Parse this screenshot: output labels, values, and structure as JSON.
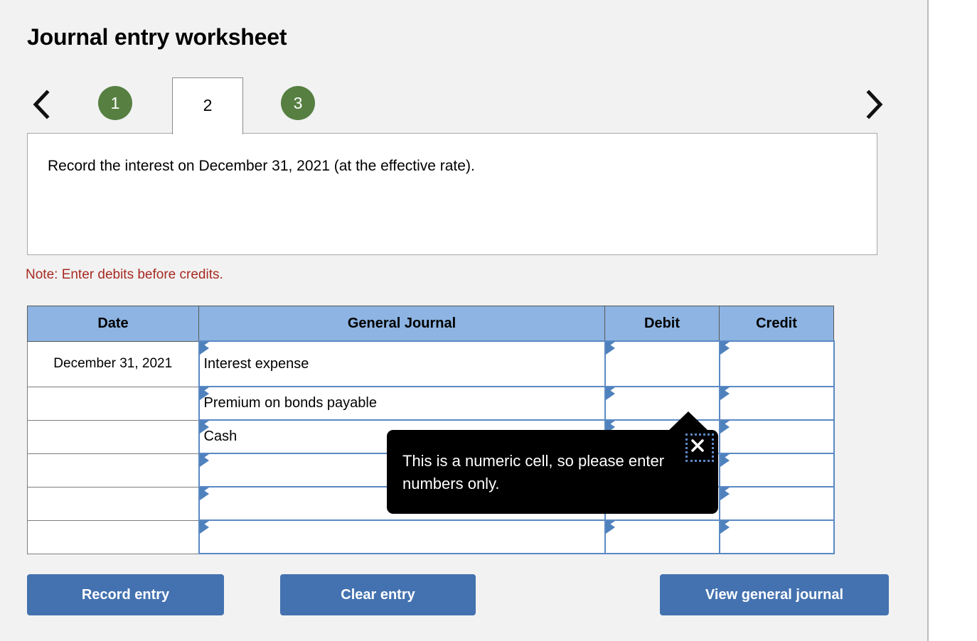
{
  "page_title": "Journal entry worksheet",
  "nav": {
    "prev_icon": "chevron-left-icon",
    "next_icon": "chevron-right-icon",
    "tabs": [
      {
        "label": "1",
        "active": false
      },
      {
        "label": "2",
        "active": true
      },
      {
        "label": "3",
        "active": false
      }
    ],
    "active_tab": "2",
    "inactive_tab_color": "#567f41"
  },
  "instruction": {
    "text": "Record the interest on December 31, 2021 (at the effective rate)."
  },
  "note": {
    "text": "Note: Enter debits before credits.",
    "color": "#a62a22"
  },
  "table": {
    "header_color": "#8db4e2",
    "columns": [
      "Date",
      "General Journal",
      "Debit",
      "Credit"
    ],
    "rows": [
      {
        "date": "December 31, 2021",
        "account": "Interest expense",
        "debit": "",
        "credit": ""
      },
      {
        "date": "",
        "account": "Premium on bonds payable",
        "debit": "",
        "credit": ""
      },
      {
        "date": "",
        "account": "Cash",
        "debit": "",
        "credit": ""
      },
      {
        "date": "",
        "account": "",
        "debit": "",
        "credit": ""
      },
      {
        "date": "",
        "account": "",
        "debit": "",
        "credit": ""
      },
      {
        "date": "",
        "account": "",
        "debit": "",
        "credit": ""
      }
    ]
  },
  "tooltip": {
    "message": "This is a numeric cell, so please enter numbers only.",
    "close_icon": "close-x-icon",
    "background": "#000000"
  },
  "buttons": {
    "record": "Record entry",
    "clear": "Clear entry",
    "view": "View general journal",
    "color": "#4472b0"
  }
}
